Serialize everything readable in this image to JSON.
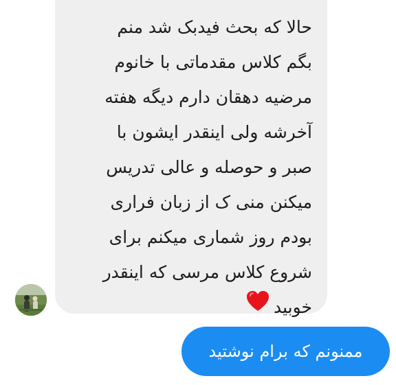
{
  "conversation": {
    "incoming_message": {
      "lines": [
        "حالا که بحث فیدبک شد منم",
        "بگم کلاس مقدماتی با خانوم",
        "مرضیه دهقان دارم دیگه هفته",
        "آخرشه ولی اینقدر ایشون با",
        "صبر و حوصله و عالی تدریس",
        "میکنن منی ک از زبان فراری",
        "بودم روز شماری میکنم برای",
        "شروع کلاس مرسی که اینقدر",
        "خوبید"
      ],
      "emoji": "red-heart-icon",
      "bubble_color": "#efefef"
    },
    "sender_avatar": "avatar-photo",
    "outgoing_message": {
      "text": "ممنونم که برام نوشتید",
      "bubble_color": "#1b8cf2",
      "text_color": "#ffffff"
    }
  }
}
